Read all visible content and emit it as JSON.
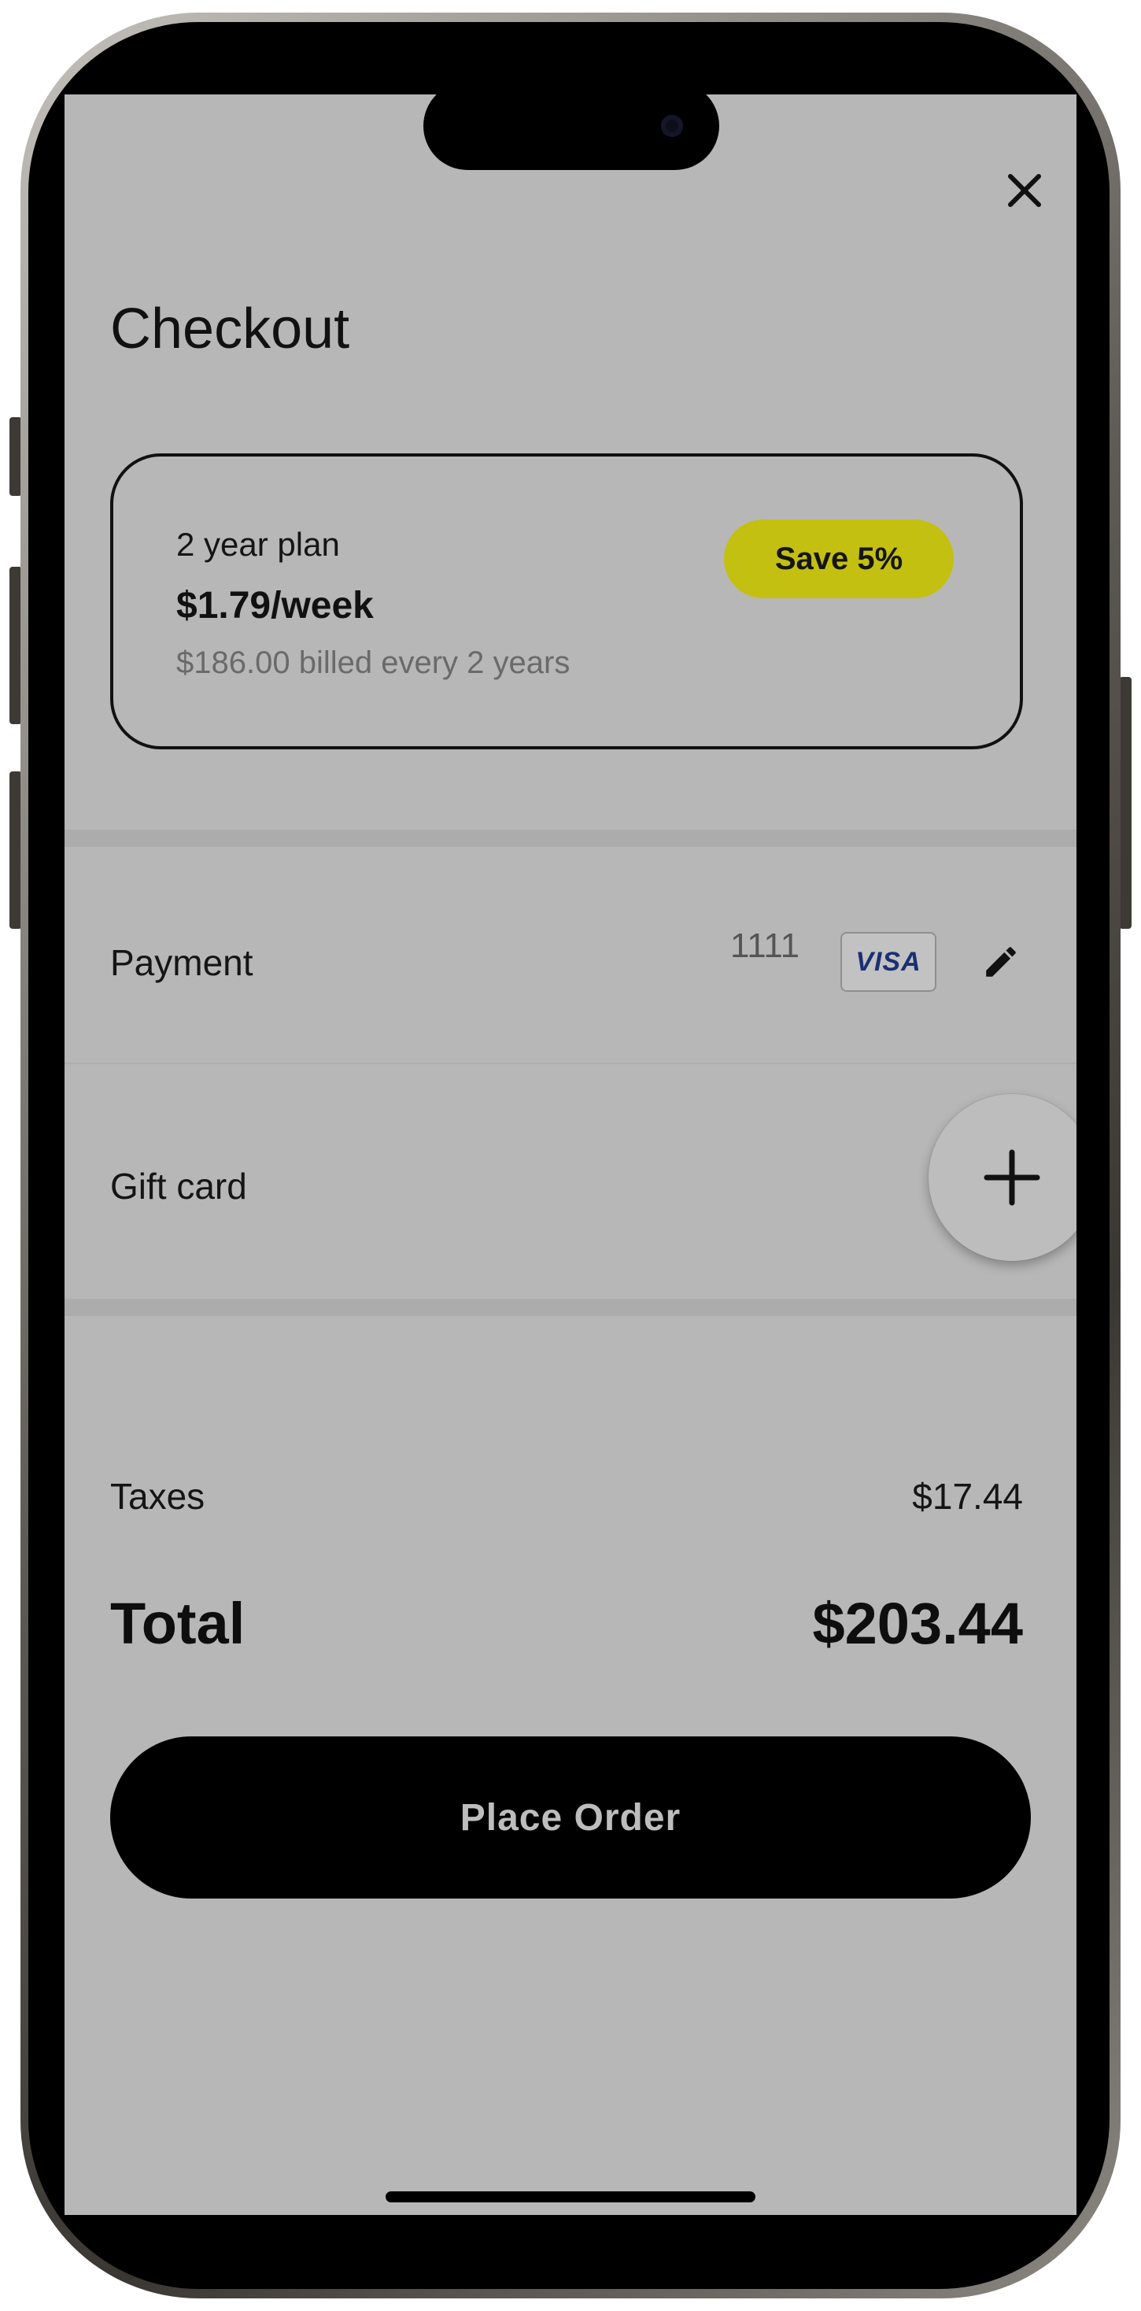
{
  "header": {
    "title": "Checkout",
    "close_icon": "close-icon"
  },
  "plan": {
    "name": "2 year plan",
    "price": "$1.79/week",
    "billing": "$186.00 billed every 2 years",
    "badge": "Save 5%",
    "badge_color": "#c3c011"
  },
  "payment": {
    "label": "Payment",
    "card_last4": "1111",
    "card_brand": "VISA",
    "edit_icon": "pencil-icon"
  },
  "gift_card": {
    "label": "Gift card",
    "add_icon": "plus-icon"
  },
  "summary": {
    "taxes_label": "Taxes",
    "taxes_value": "$17.44",
    "total_label": "Total",
    "total_value": "$203.44"
  },
  "actions": {
    "place_order_label": "Place Order"
  },
  "colors": {
    "screen_overlay": "#b7b7b7",
    "primary_button": "#000000",
    "text": "#111111"
  }
}
